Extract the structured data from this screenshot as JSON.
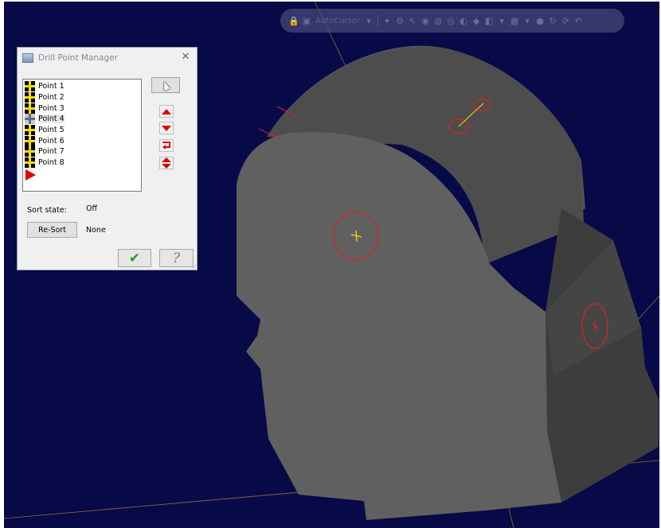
{
  "dialog": {
    "title": "Drill Point Manager",
    "points": [
      "Point 1",
      "Point 2",
      "Point 3",
      "Point 4",
      "Point 5",
      "Point 6",
      "Point 7",
      "Point 8"
    ],
    "selected_point": "Point 4",
    "sort_state_label": "Sort state:",
    "sort_state_value": "Off",
    "resort_label": "Re-Sort",
    "resort_value": "None"
  },
  "toolbar": {
    "autocursor_label": "AutoCursor"
  },
  "colors": {
    "viewport_bg": "#070a46",
    "model_face": "#5a5a5a",
    "drill_circle": "#e02020",
    "point_marker": "#f5dc00",
    "arrow_red": "#e00000",
    "ok_green": "#2a9b1a"
  },
  "icons": [
    "window-icon",
    "close-icon",
    "point-icon",
    "end-marker-icon",
    "cursor-icon",
    "move-up-icon",
    "move-down-icon",
    "reverse-icon",
    "swap-icon",
    "ok-checkmark-icon",
    "help-icon"
  ]
}
